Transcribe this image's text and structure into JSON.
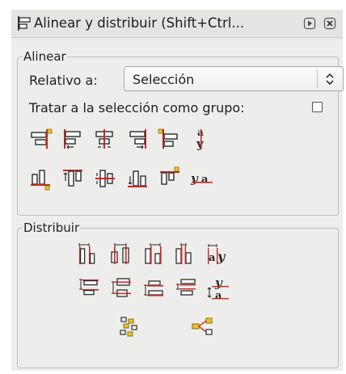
{
  "window": {
    "title": "Alinear y distribuir (Shift+Ctrl...",
    "icons": {
      "dialog": "align-dialog-icon",
      "pin": "pin-panel-icon",
      "close": "close-panel-icon"
    }
  },
  "align": {
    "legend": "Alinear",
    "relative_label": "Relativo a:",
    "relative_value": "Selección",
    "group_label": "Tratar a la selección como grupo:",
    "group_checked": false
  },
  "distribute": {
    "legend": "Distribuir"
  },
  "colors": {
    "accent_red": "#c8281e",
    "accent_yellow": "#f0c02a",
    "icon_dark": "#2b2b2b"
  }
}
